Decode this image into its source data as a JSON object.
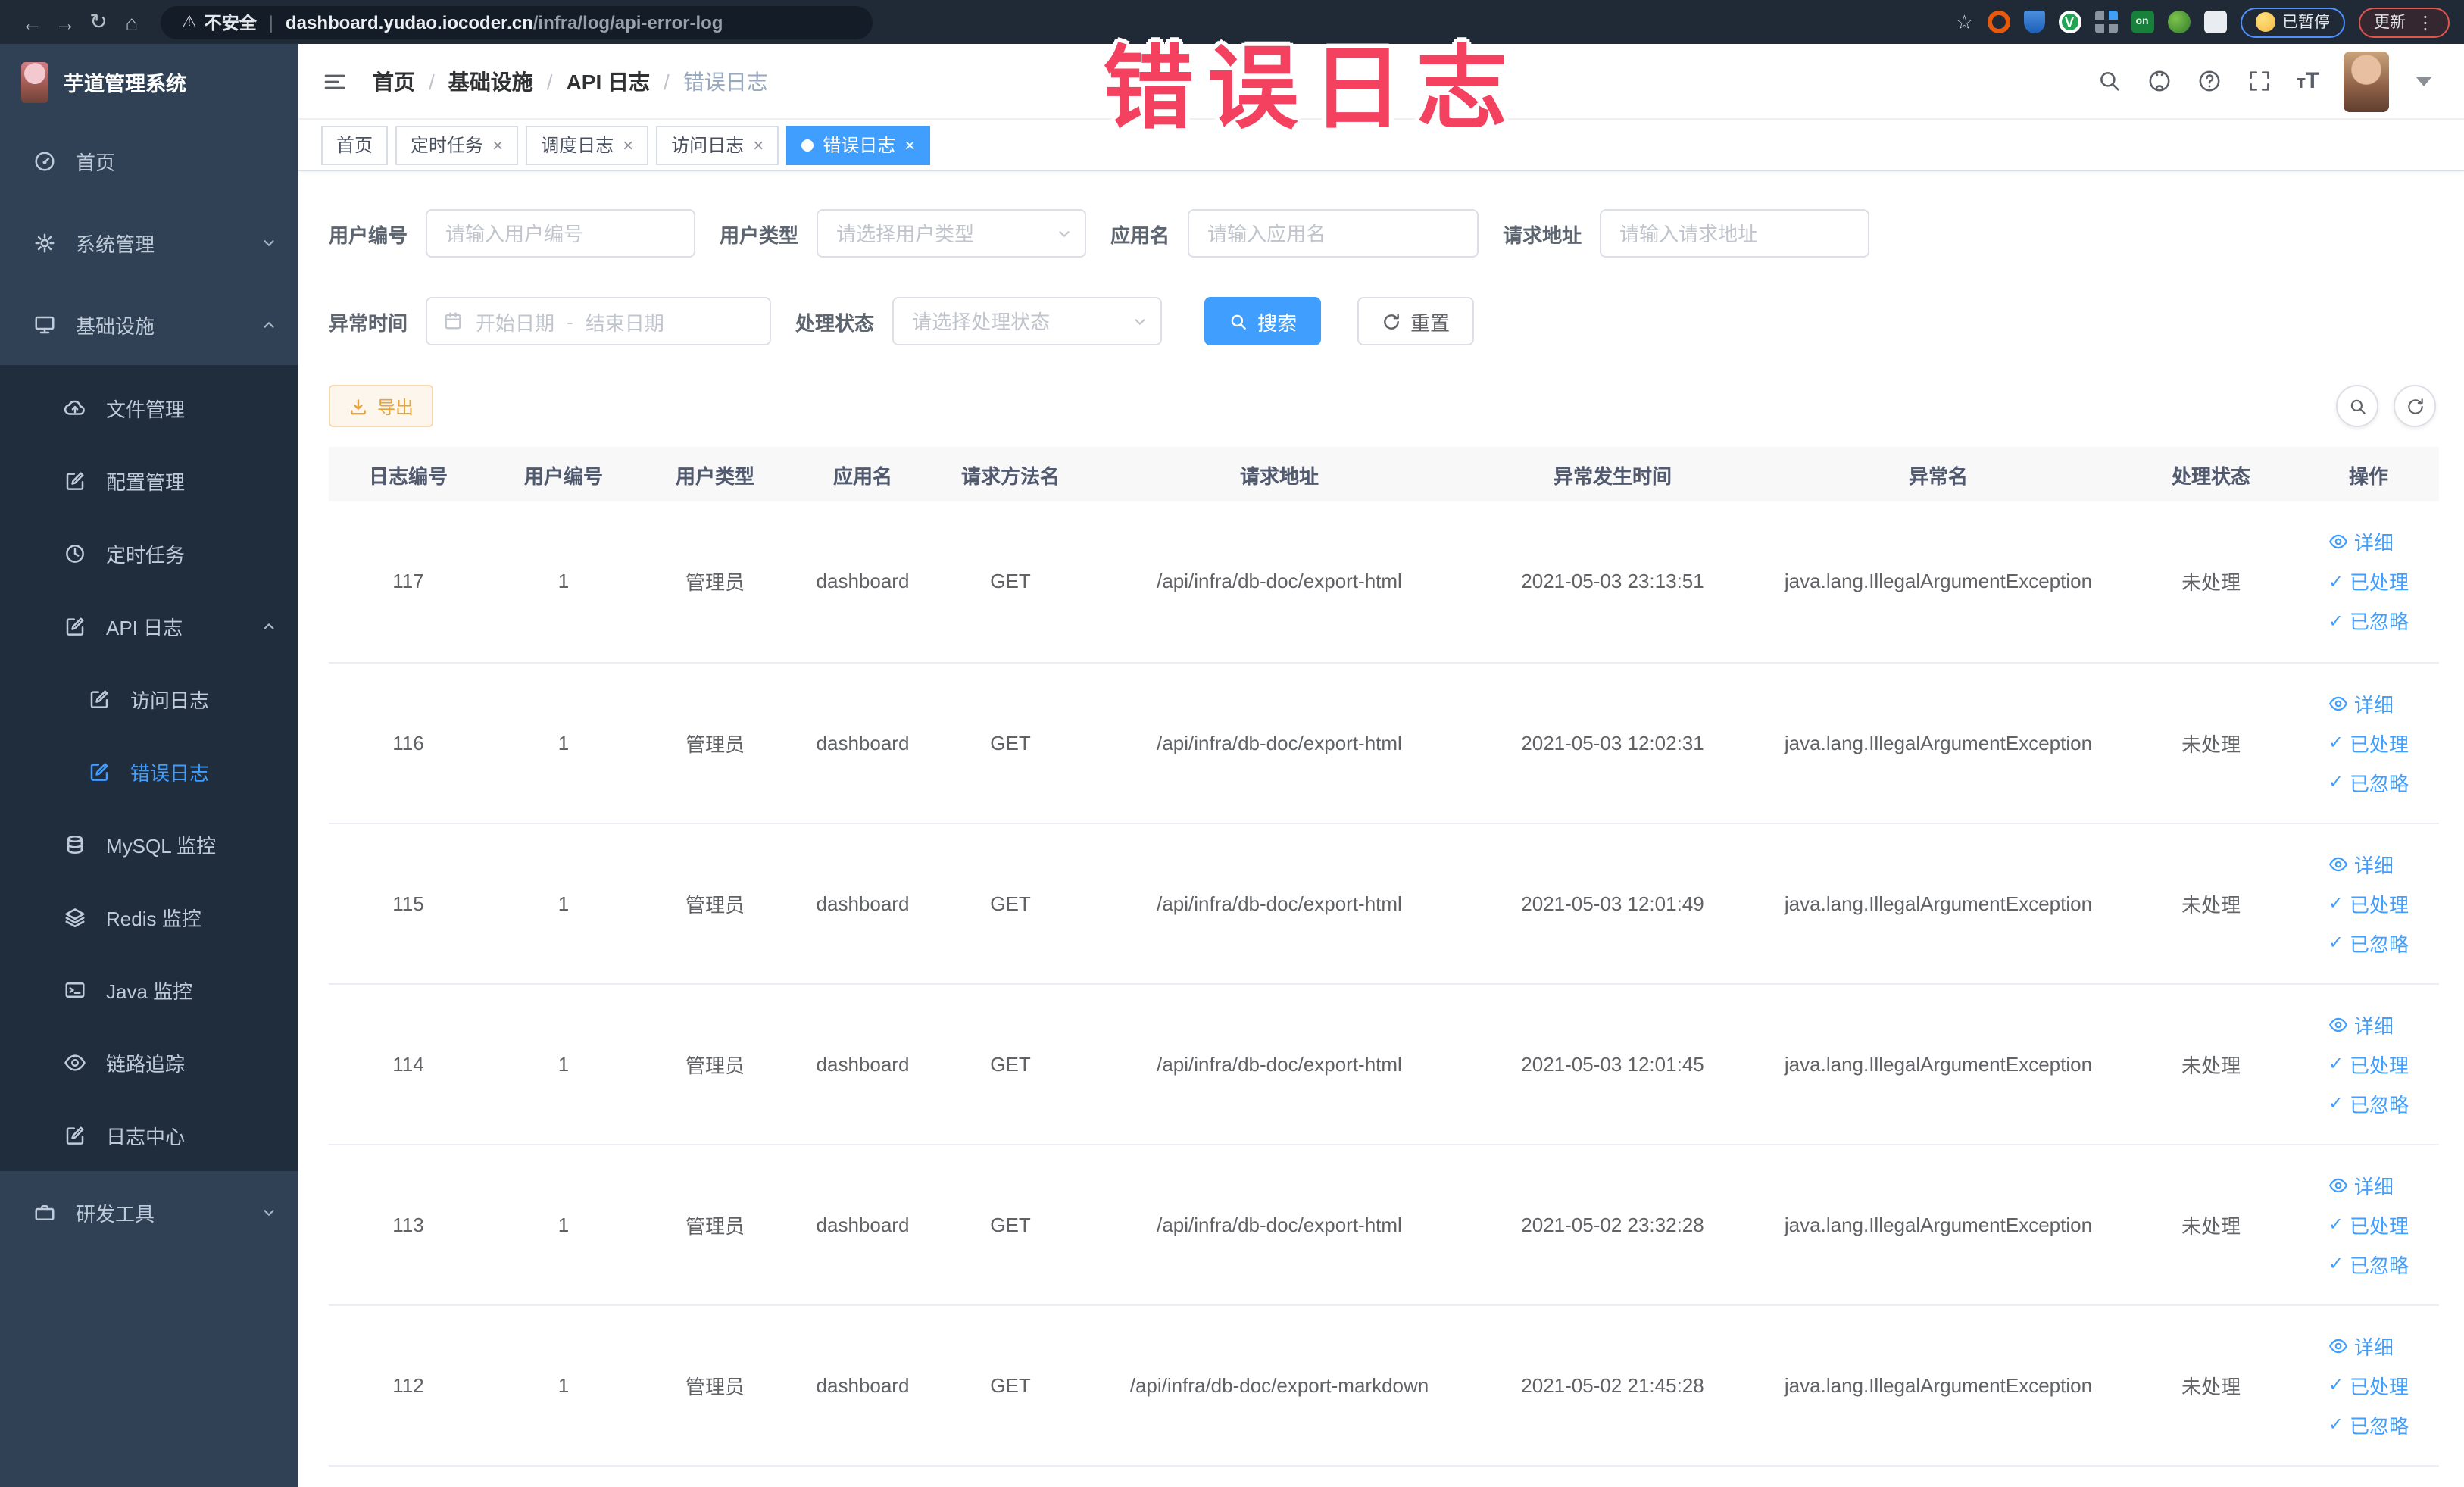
{
  "browser": {
    "security_warning": "不安全",
    "url_domain": "dashboard.yudao.iocoder.cn",
    "url_path": "/infra/log/api-error-log",
    "paused_badge": "已暂停",
    "update_badge": "更新"
  },
  "annotation": {
    "text": "错误日志",
    "color": "#f4415f"
  },
  "sidebar": {
    "logo_title": "芋道管理系统",
    "items": [
      {
        "label": "首页",
        "icon": "gauge-icon",
        "level": 1
      },
      {
        "label": "系统管理",
        "icon": "gear-icon",
        "level": 1,
        "chevron": "down"
      },
      {
        "label": "基础设施",
        "icon": "monitor-icon",
        "level": 1,
        "chevron": "up",
        "expanded": true
      },
      {
        "label": "文件管理",
        "icon": "cloud-upload-icon",
        "level": 2
      },
      {
        "label": "配置管理",
        "icon": "edit-icon",
        "level": 2
      },
      {
        "label": "定时任务",
        "icon": "clock-icon",
        "level": 2
      },
      {
        "label": "API 日志",
        "icon": "edit-icon",
        "level": 2,
        "chevron": "up",
        "expanded": true
      },
      {
        "label": "访问日志",
        "icon": "edit-icon",
        "level": 3
      },
      {
        "label": "错误日志",
        "icon": "edit-icon",
        "level": 3,
        "active": true
      },
      {
        "label": "MySQL 监控",
        "icon": "database-icon",
        "level": 2
      },
      {
        "label": "Redis 监控",
        "icon": "layers-icon",
        "level": 2
      },
      {
        "label": "Java 监控",
        "icon": "terminal-icon",
        "level": 2
      },
      {
        "label": "链路追踪",
        "icon": "eye-icon",
        "level": 2
      },
      {
        "label": "日志中心",
        "icon": "edit-icon",
        "level": 2
      },
      {
        "label": "研发工具",
        "icon": "briefcase-icon",
        "level": 1,
        "chevron": "down"
      }
    ]
  },
  "breadcrumb": {
    "items": [
      "首页",
      "基础设施",
      "API 日志",
      "错误日志"
    ]
  },
  "tabs": [
    {
      "label": "首页",
      "closable": false,
      "active": false
    },
    {
      "label": "定时任务",
      "closable": true,
      "active": false
    },
    {
      "label": "调度日志",
      "closable": true,
      "active": false
    },
    {
      "label": "访问日志",
      "closable": true,
      "active": false
    },
    {
      "label": "错误日志",
      "closable": true,
      "active": true
    }
  ],
  "filters": {
    "user_id": {
      "label": "用户编号",
      "placeholder": "请输入用户编号"
    },
    "user_type": {
      "label": "用户类型",
      "placeholder": "请选择用户类型"
    },
    "app_name": {
      "label": "应用名",
      "placeholder": "请输入应用名"
    },
    "request_url": {
      "label": "请求地址",
      "placeholder": "请输入请求地址"
    },
    "exception_time": {
      "label": "异常时间",
      "start_placeholder": "开始日期",
      "separator": "-",
      "end_placeholder": "结束日期"
    },
    "process_status": {
      "label": "处理状态",
      "placeholder": "请选择处理状态"
    },
    "search_label": "搜索",
    "reset_label": "重置"
  },
  "toolbar": {
    "export_label": "导出"
  },
  "table": {
    "columns": [
      "日志编号",
      "用户编号",
      "用户类型",
      "应用名",
      "请求方法名",
      "请求地址",
      "异常发生时间",
      "异常名",
      "处理状态",
      "操作"
    ],
    "action_labels": [
      "详细",
      "已处理",
      "已忽略"
    ],
    "rows": [
      {
        "id": "117",
        "user_id": "1",
        "user_type": "管理员",
        "app_name": "dashboard",
        "method": "GET",
        "url": "/api/infra/db-doc/export-html",
        "time": "2021-05-03 23:13:51",
        "exception": "java.lang.IllegalArgumentException",
        "status": "未处理"
      },
      {
        "id": "116",
        "user_id": "1",
        "user_type": "管理员",
        "app_name": "dashboard",
        "method": "GET",
        "url": "/api/infra/db-doc/export-html",
        "time": "2021-05-03 12:02:31",
        "exception": "java.lang.IllegalArgumentException",
        "status": "未处理"
      },
      {
        "id": "115",
        "user_id": "1",
        "user_type": "管理员",
        "app_name": "dashboard",
        "method": "GET",
        "url": "/api/infra/db-doc/export-html",
        "time": "2021-05-03 12:01:49",
        "exception": "java.lang.IllegalArgumentException",
        "status": "未处理"
      },
      {
        "id": "114",
        "user_id": "1",
        "user_type": "管理员",
        "app_name": "dashboard",
        "method": "GET",
        "url": "/api/infra/db-doc/export-html",
        "time": "2021-05-03 12:01:45",
        "exception": "java.lang.IllegalArgumentException",
        "status": "未处理"
      },
      {
        "id": "113",
        "user_id": "1",
        "user_type": "管理员",
        "app_name": "dashboard",
        "method": "GET",
        "url": "/api/infra/db-doc/export-html",
        "time": "2021-05-02 23:32:28",
        "exception": "java.lang.IllegalArgumentException",
        "status": "未处理"
      },
      {
        "id": "112",
        "user_id": "1",
        "user_type": "管理员",
        "app_name": "dashboard",
        "method": "GET",
        "url": "/api/infra/db-doc/export-markdown",
        "time": "2021-05-02 21:45:28",
        "exception": "java.lang.IllegalArgumentException",
        "status": "未处理"
      }
    ]
  }
}
